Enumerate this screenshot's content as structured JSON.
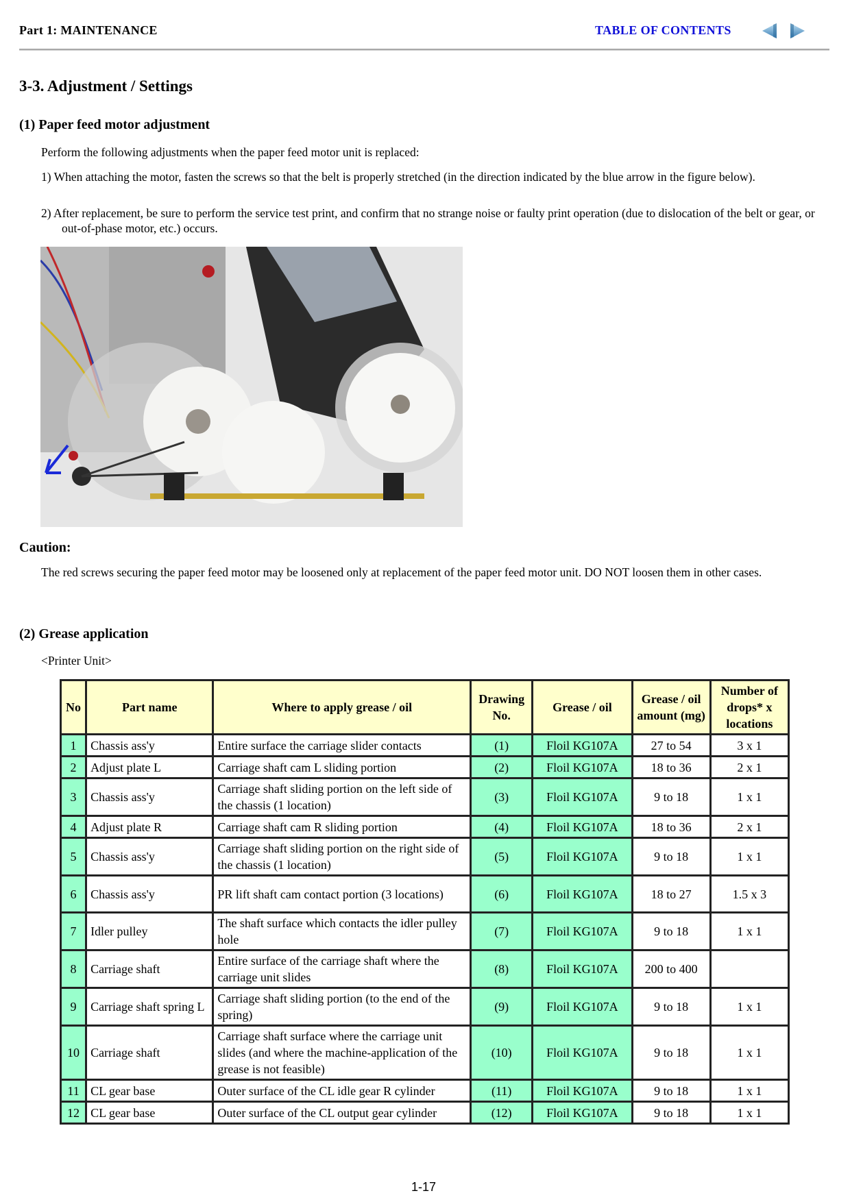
{
  "header": {
    "part_label": "Part 1:  MAINTENANCE",
    "toc_link": "TABLE OF CONTENTS",
    "prev_icon": "arrow-left-icon",
    "next_icon": "arrow-right-icon"
  },
  "section_title": "3-3.  Adjustment / Settings",
  "subsection1": {
    "title": "(1)  Paper feed motor adjustment",
    "intro": "Perform the following adjustments when the paper feed motor unit is replaced:",
    "steps": [
      "1) When attaching the motor, fasten the screws so that the belt is properly stretched (in the direction indicated by the blue arrow in the figure below).",
      "2) After replacement, be sure to perform the service test print, and confirm that no strange noise or faulty print operation (due to dislocation of the belt or gear, or out-of-phase motor, etc.) occurs."
    ],
    "figure": "photo of paper feed motor, belt and gears with blue arrow"
  },
  "caution": {
    "title": "Caution:",
    "text": "The red screws securing the paper feed motor may be loosened only at replacement of the paper feed motor unit. DO NOT loosen them in other cases."
  },
  "subsection2": {
    "title": "(2)  Grease application",
    "unit_label": "<Printer Unit>"
  },
  "table": {
    "headers": [
      "No",
      "Part name",
      "Where to apply grease / oil",
      "Drawing No.",
      "Grease / oil",
      "Grease / oil amount (mg)",
      "Number of drops* x locations"
    ],
    "rows": [
      [
        "1",
        "Chassis ass'y",
        "Entire surface the carriage slider contacts",
        "(1)",
        "Floil KG107A",
        "27 to 54",
        "3 x 1"
      ],
      [
        "2",
        "Adjust plate L",
        "Carriage shaft cam L sliding portion",
        "(2)",
        "Floil KG107A",
        "18 to 36",
        "2 x 1"
      ],
      [
        "3",
        "Chassis ass'y",
        "Carriage shaft sliding portion on the left side of the chassis (1 location)",
        "(3)",
        "Floil KG107A",
        "9 to 18",
        "1 x 1"
      ],
      [
        "4",
        "Adjust plate R",
        "Carriage shaft cam R sliding portion",
        "(4)",
        "Floil KG107A",
        "18 to 36",
        "2 x 1"
      ],
      [
        "5",
        "Chassis ass'y",
        "Carriage shaft sliding portion on the right side of the chassis (1 location)",
        "(5)",
        "Floil KG107A",
        "9 to 18",
        "1 x 1"
      ],
      [
        "6",
        "Chassis ass'y",
        "PR lift shaft cam contact portion (3 locations)",
        "(6)",
        "Floil KG107A",
        "18 to 27",
        "1.5 x 3"
      ],
      [
        "7",
        "Idler pulley",
        "The shaft surface which contacts the idler pulley hole",
        "(7)",
        "Floil KG107A",
        "9 to 18",
        "1 x 1"
      ],
      [
        "8",
        "Carriage shaft",
        "Entire surface of the carriage shaft where the carriage unit slides",
        "(8)",
        "Floil KG107A",
        "200 to 400",
        ""
      ],
      [
        "9",
        "Carriage shaft spring L",
        "Carriage shaft sliding portion (to the end of the spring)",
        "(9)",
        "Floil KG107A",
        "9 to 18",
        "1 x 1"
      ],
      [
        "10",
        "Carriage shaft",
        "Carriage shaft surface where the carriage unit slides (and where the machine-application of the grease is not feasible)",
        "(10)",
        "Floil KG107A",
        "9 to 18",
        "1 x 1"
      ],
      [
        "11",
        "CL gear base",
        "Outer surface of the CL idle gear R cylinder",
        "(11)",
        "Floil KG107A",
        "9 to 18",
        "1 x 1"
      ],
      [
        "12",
        "CL gear base",
        "Outer surface of the CL output gear cylinder",
        "(12)",
        "Floil KG107A",
        "9 to 18",
        "1 x 1"
      ]
    ]
  },
  "footer": {
    "page_number": "1-17"
  },
  "colors": {
    "link": "#1010d8",
    "header_bg": "#ffffcc",
    "green_cell": "#99ffcc"
  }
}
